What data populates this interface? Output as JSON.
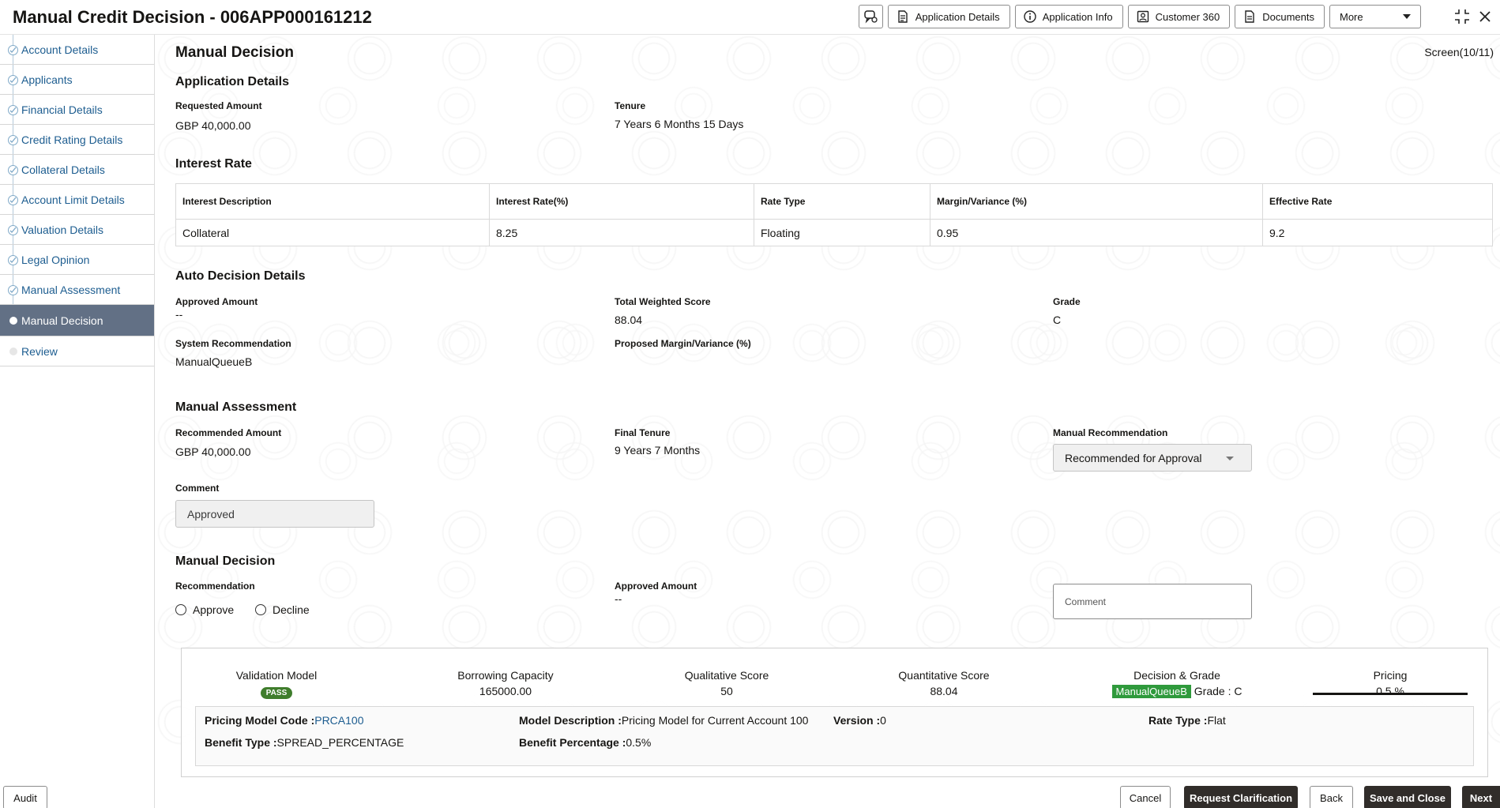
{
  "header": {
    "title": "Manual Credit Decision - 006APP000161212",
    "buttons": {
      "application_details": "Application Details",
      "application_info": "Application Info",
      "customer_360": "Customer 360",
      "documents": "Documents",
      "more": "More"
    }
  },
  "sidebar": {
    "items": [
      {
        "label": "Account Details"
      },
      {
        "label": "Applicants"
      },
      {
        "label": "Financial Details"
      },
      {
        "label": "Credit Rating Details"
      },
      {
        "label": "Collateral Details"
      },
      {
        "label": "Account Limit Details"
      },
      {
        "label": "Valuation Details"
      },
      {
        "label": "Legal Opinion"
      },
      {
        "label": "Manual Assessment"
      },
      {
        "label": "Manual Decision"
      },
      {
        "label": "Review"
      }
    ],
    "active_index": 9
  },
  "main": {
    "title": "Manual Decision",
    "screen_indicator": "Screen(10/11)",
    "application_details": {
      "heading": "Application Details",
      "requested_amount_label": "Requested Amount",
      "requested_amount": "GBP 40,000.00",
      "tenure_label": "Tenure",
      "tenure": "7 Years 6 Months 15 Days"
    },
    "interest_rate": {
      "heading": "Interest Rate",
      "columns": [
        "Interest Description",
        "Interest Rate(%)",
        "Rate Type",
        "Margin/Variance (%)",
        "Effective Rate"
      ],
      "rows": [
        [
          "Collateral",
          "8.25",
          "Floating",
          "0.95",
          "9.2"
        ]
      ]
    },
    "auto_decision": {
      "heading": "Auto Decision Details",
      "approved_amount_label": "Approved Amount",
      "approved_amount": "--",
      "total_weighted_score_label": "Total Weighted Score",
      "total_weighted_score": "88.04",
      "grade_label": "Grade",
      "grade": "C",
      "system_recommendation_label": "System Recommendation",
      "system_recommendation": "ManualQueueB",
      "proposed_margin_label": "Proposed Margin/Variance (%)"
    },
    "manual_assessment": {
      "heading": "Manual Assessment",
      "recommended_amount_label": "Recommended Amount",
      "recommended_amount": "GBP 40,000.00",
      "final_tenure_label": "Final Tenure",
      "final_tenure": "9 Years 7 Months",
      "manual_recommendation_label": "Manual Recommendation",
      "manual_recommendation": "Recommended for Approval",
      "comment_label": "Comment",
      "comment": "Approved"
    },
    "manual_decision": {
      "heading": "Manual Decision",
      "recommendation_label": "Recommendation",
      "approve_label": "Approve",
      "decline_label": "Decline",
      "approved_amount_label": "Approved Amount",
      "approved_amount": "--",
      "comment_placeholder": "Comment"
    },
    "summary": {
      "validation_model_label": "Validation Model",
      "validation_model": "PASS",
      "borrowing_capacity_label": "Borrowing Capacity",
      "borrowing_capacity": "165000.00",
      "qualitative_score_label": "Qualitative Score",
      "qualitative_score": "50",
      "quantitative_score_label": "Quantitative Score",
      "quantitative_score": "88.04",
      "decision_grade_label": "Decision & Grade",
      "decision": "ManualQueueB",
      "grade": "Grade : C",
      "pricing_label": "Pricing",
      "pricing": "0.5 %",
      "pricing_details": {
        "model_code_label": "Pricing Model Code :",
        "model_code": "PRCA100",
        "model_description_label": "Model Description :",
        "model_description": "Pricing Model for Current Account 100",
        "version_label": "Version :",
        "version": "0",
        "rate_type_label": "Rate Type :",
        "rate_type": "Flat",
        "benefit_type_label": "Benefit Type :",
        "benefit_type": "SPREAD_PERCENTAGE",
        "benefit_percentage_label": "Benefit Percentage :",
        "benefit_percentage": "0.5%"
      }
    }
  },
  "footer": {
    "audit": "Audit",
    "cancel": "Cancel",
    "request_clarification": "Request Clarification",
    "back": "Back",
    "save_and_close": "Save and Close",
    "next": "Next"
  },
  "colors": {
    "active_nav": "#627085",
    "link": "#1d5d90",
    "pass_green": "#3f7d2c",
    "decision_green": "#2f9a3c",
    "dark_button": "#312d2a"
  }
}
